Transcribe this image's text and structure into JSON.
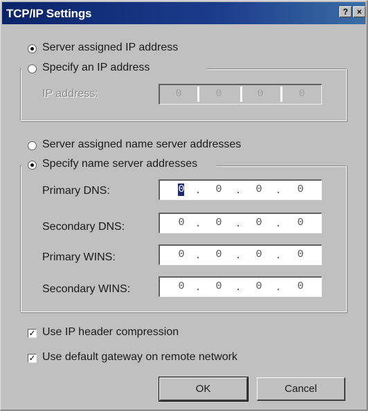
{
  "window": {
    "title": "TCP/IP Settings",
    "help_button": "?",
    "close_button": "×"
  },
  "ip_section": {
    "server_assigned_label": "Server assigned IP address",
    "specify_label": "Specify an IP address",
    "ip_address_label": "IP address:",
    "ip_address_octets": [
      "0",
      "0",
      "0",
      "0"
    ],
    "selected": "server_assigned",
    "specify_enabled": false
  },
  "dns_section": {
    "server_assigned_label": "Server assigned name server addresses",
    "specify_label": "Specify name server addresses",
    "selected": "specify",
    "fields": [
      {
        "label": "Primary DNS:",
        "octets": [
          "0",
          "0",
          "0",
          "0"
        ]
      },
      {
        "label": "Secondary DNS:",
        "octets": [
          "0",
          "0",
          "0",
          "0"
        ]
      },
      {
        "label": "Primary WINS:",
        "octets": [
          "0",
          "0",
          "0",
          "0"
        ]
      },
      {
        "label": "Secondary WINS:",
        "octets": [
          "0",
          "0",
          "0",
          "0"
        ]
      }
    ]
  },
  "options": {
    "ip_header_compression_label": "Use IP header compression",
    "ip_header_compression_checked": true,
    "default_gateway_label": "Use default gateway on remote network",
    "default_gateway_checked": true
  },
  "buttons": {
    "ok_label": "OK",
    "cancel_label": "Cancel"
  },
  "colors": {
    "title_bar": "#0a246a",
    "dialog_face": "#c0c0c0",
    "field_bg": "#ffffff"
  }
}
